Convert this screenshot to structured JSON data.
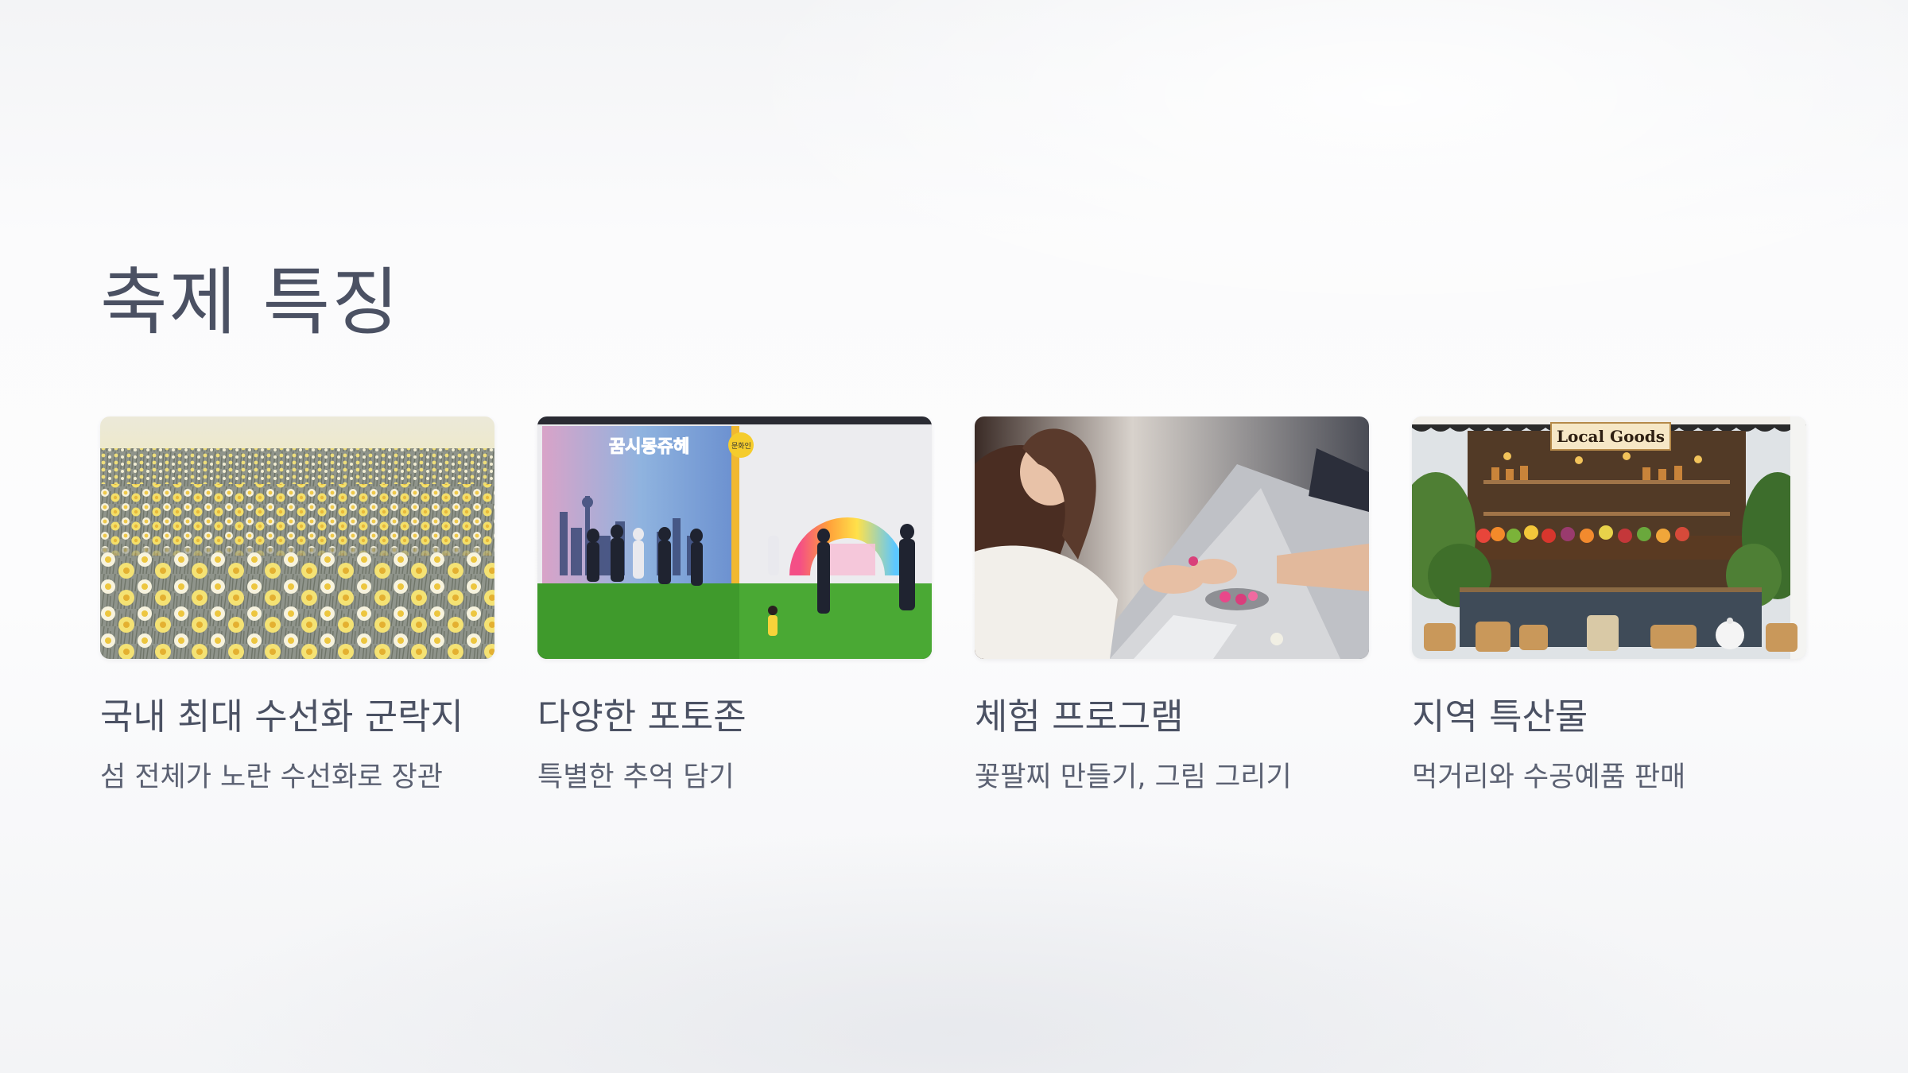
{
  "slide": {
    "title": "축제 특징"
  },
  "cards": [
    {
      "title": "국내 최대 수선화 군락지",
      "description": "섬 전체가 노란 수선화로 장관"
    },
    {
      "title": "다양한 포토존",
      "description": "특별한 추억 담기",
      "photo_sign": "꿈시몽쥬헤",
      "photo_badge": "문화인"
    },
    {
      "title": "체험 프로그램",
      "description": "꽃팔찌 만들기, 그림 그리기"
    },
    {
      "title": "지역 특산물",
      "description": "먹거리와 수공예품 판매",
      "photo_sign": "Local Goods"
    }
  ],
  "colors": {
    "heading": "#4b5163",
    "body_text": "#5b6172",
    "daffodil_yellow": "#f2df6e",
    "turf_green": "#3f9a2c"
  }
}
